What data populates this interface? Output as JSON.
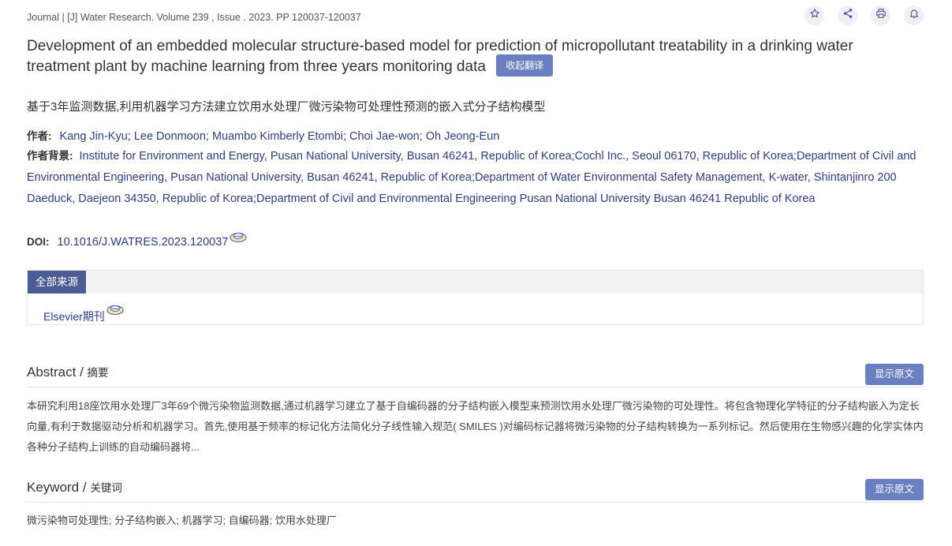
{
  "journal_line": "Journal | [J] Water Research. Volume 239 , Issue . 2023. PP 120037-120037",
  "actions": [
    {
      "name": "star-icon"
    },
    {
      "name": "share-icon"
    },
    {
      "name": "print-icon"
    },
    {
      "name": "bell-icon"
    }
  ],
  "title": "Development of an embedded molecular structure-based model for prediction of micropollutant treatability in a drinking water treatment plant by machine learning from three years monitoring data",
  "collapse_translation_label": "收起翻译",
  "cn_title": "基于3年监测数据,利用机器学习方法建立饮用水处理厂微污染物可处理性预测的嵌入式分子结构模型",
  "authors_label": "作者:",
  "authors": "Kang Jin-Kyu; Lee Donmoon; Muambo Kimberly Etombi; Choi Jae-won; Oh Jeong-Eun",
  "affiliation_label": "作者背景:",
  "affiliation": "Institute for Environment and Energy, Pusan National University, Busan 46241, Republic of Korea;Cochl Inc., Seoul 06170, Republic of Korea;Department of Civil and Environmental Engineering, Pusan National University, Busan 46241, Republic of Korea;Department of Water Environmental Safety Management, K-water, Shintanjinro 200 Daeduck, Daejeon 34350, Republic of Korea;Department of Civil and Environmental Engineering Pusan National University Busan 46241 Republic of Korea",
  "doi_label": "DOI:",
  "doi": "10.1016/J.WATRES.2023.120037",
  "sources": {
    "tab_label": "全部来源",
    "items": [
      "Elsevier期刊"
    ]
  },
  "abstract": {
    "title_en": "Abstract /",
    "title_cn": "摘要",
    "show_original_label": "显示原文",
    "text": "本研究利用18座饮用水处理厂3年69个微污染物监测数据,通过机器学习建立了基于自编码器的分子结构嵌入模型来预测饮用水处理厂微污染物的可处理性。将包含物理化学特征的分子结构嵌入为定长向量,有利于数据驱动分析和机器学习。首先,使用基于频率的标记化方法简化分子线性输入规范( SMILES )对编码标记器将微污染物的分子结构转换为一系列标记。然后使用在生物感兴趣的化学实体内各种分子结构上训练的自动编码器将..."
  },
  "keyword": {
    "title_en": "Keyword /",
    "title_cn": "关键词",
    "show_original_label": "显示原文",
    "text": "微污染物可处理性; 分子结构嵌入; 机器学习; 自编码器; 饮用水处理厂"
  },
  "colors": {
    "accent_button": "#6a7fc0",
    "tab_dark": "#4d5b94",
    "link": "#2f3c7e"
  }
}
